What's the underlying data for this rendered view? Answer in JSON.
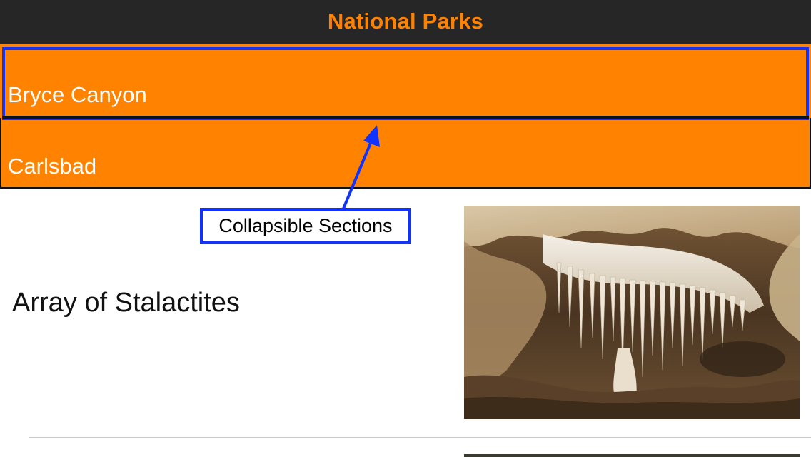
{
  "navbar": {
    "title": "National Parks"
  },
  "sections": [
    {
      "label": "Bryce Canyon"
    },
    {
      "label": "Carlsbad"
    }
  ],
  "annotation": {
    "callout_text": "Collapsible Sections"
  },
  "rows": [
    {
      "title": "Array of Stalactites",
      "image": "cave-stalactites-photo"
    }
  ],
  "colors": {
    "accent": "#ff8200",
    "navbar_bg": "#262626",
    "annotation_blue": "#1133ff",
    "header_text": "#ffffff"
  }
}
